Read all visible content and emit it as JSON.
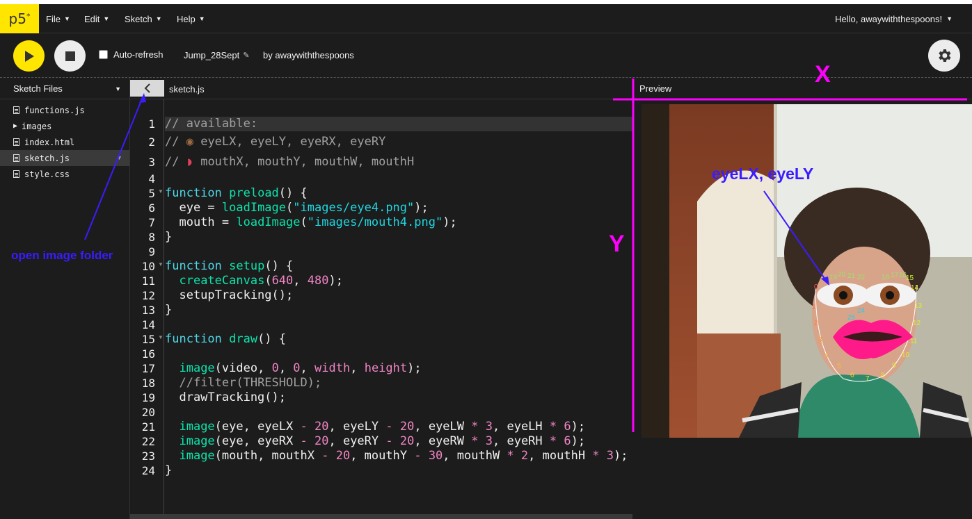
{
  "navbar": {
    "logo": "p5",
    "logo_sup": "*",
    "menus": [
      "File",
      "Edit",
      "Sketch",
      "Help"
    ],
    "user": "Hello, awaywiththespoons!"
  },
  "toolbar": {
    "autorefresh_label": "Auto-refresh",
    "sketch_name": "Jump_28Sept",
    "byline": "by awaywiththespoons"
  },
  "sidebar": {
    "title": "Sketch Files",
    "files": [
      {
        "name": "functions.js",
        "type": "file"
      },
      {
        "name": "images",
        "type": "folder"
      },
      {
        "name": "index.html",
        "type": "file"
      },
      {
        "name": "sketch.js",
        "type": "file",
        "active": true
      },
      {
        "name": "style.css",
        "type": "file"
      }
    ]
  },
  "editor": {
    "tab": "sketch.js",
    "line_numbers": [
      "1",
      "2",
      "3",
      "4",
      "5",
      "6",
      "7",
      "8",
      "9",
      "10",
      "11",
      "12",
      "13",
      "14",
      "15",
      "16",
      "17",
      "18",
      "19",
      "20",
      "21",
      "22",
      "23",
      "24"
    ]
  },
  "preview": {
    "title": "Preview"
  },
  "annotations": {
    "x_label": "X",
    "y_label": "Y",
    "eye_label": "eyeLX, eyeLY",
    "folder_label": "open image folder"
  },
  "colors": {
    "brand_yellow": "#ffe600",
    "annotation_magenta": "#ff00ff",
    "annotation_blue": "#3a1cff"
  }
}
